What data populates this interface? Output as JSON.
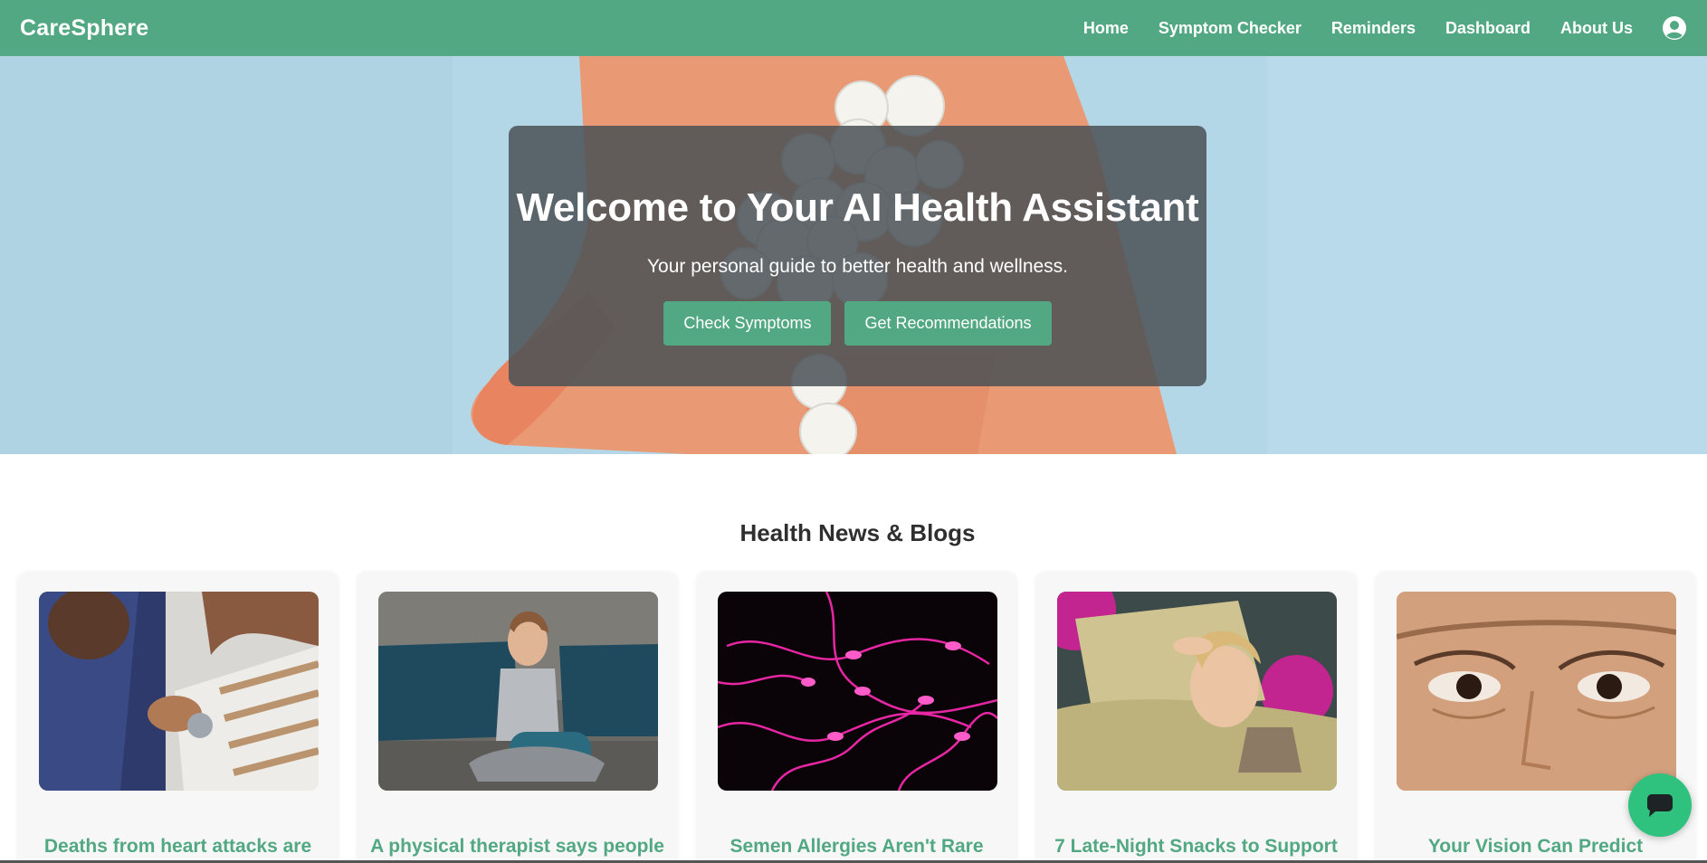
{
  "nav": {
    "brand": "CareSphere",
    "links": [
      "Home",
      "Symptom Checker",
      "Reminders",
      "Dashboard",
      "About Us"
    ],
    "profile_icon": "user-circle-icon"
  },
  "hero": {
    "title": "Welcome to Your AI Health Assistant",
    "subtitle": "Your personal guide to better health and wellness.",
    "buttons": [
      "Check Symptoms",
      "Get Recommendations"
    ]
  },
  "news": {
    "heading": "Health News & Blogs",
    "cards": [
      {
        "title": "Deaths from heart attacks are"
      },
      {
        "title": "A physical therapist says people"
      },
      {
        "title": "Semen Allergies Aren't Rare"
      },
      {
        "title": "7 Late-Night Snacks to Support"
      },
      {
        "title": "Your Vision Can Predict"
      }
    ]
  },
  "chat": {
    "icon": "chat-bubble-icon"
  },
  "colors": {
    "primary": "#52a882",
    "chat": "#2ec27e",
    "overlay": "#4b5256"
  }
}
